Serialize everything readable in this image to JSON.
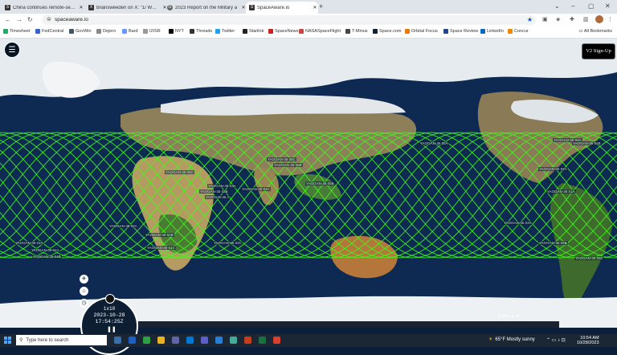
{
  "browser": {
    "tabs": [
      {
        "title": "China continues remote-sens",
        "icon": "S",
        "active": false
      },
      {
        "title": "briansweeden on X: \"1/ While",
        "icon": "X",
        "active": false
      },
      {
        "title": "2023 Report on the Military a",
        "icon": "G",
        "active": false
      },
      {
        "title": "SpaceAware.io",
        "icon": "S",
        "active": true
      }
    ],
    "new_tab": "+",
    "url": "spaceaware.io",
    "bookmarks": [
      "Timesheet",
      "FedCentral",
      "GovWin",
      "Dejero",
      "Bard",
      "I2ISR",
      "NYT",
      "Threads",
      "Twitter",
      "Starlink",
      "SpaceNews",
      "NASASpaceFlight",
      "T-Minus",
      "Space.com",
      "Orbital Focus",
      "Space Review",
      "LinkedIn",
      "Concur"
    ],
    "all_bookmarks": "All Bookmarks"
  },
  "app": {
    "signup_label": "V2 Sign-Up",
    "clock": {
      "speed": "1x10",
      "date": "2023-10-28",
      "time": "17:54:25Z"
    },
    "zoom_label": "1 DAY",
    "orbit_color": "#39ff14",
    "satellites": [
      {
        "name": "YAOGAN-39 05C"
      },
      {
        "name": "YAOGAN-36 06C"
      },
      {
        "name": "YAOGAN-36 06B"
      },
      {
        "name": "YAOGAN-36 05B"
      },
      {
        "name": "YAOGAN-36 05A"
      },
      {
        "name": "YAOGAN-35 03A"
      },
      {
        "name": "YAOGAN-35 03B"
      },
      {
        "name": "YAOGAN-35 04A"
      },
      {
        "name": "YAOGAN-35 A"
      },
      {
        "name": "YAOGAN-36 04A"
      },
      {
        "name": "YAOGAN-36 04B"
      },
      {
        "name": "YAOGAN-36 02A"
      },
      {
        "name": "YAOGAN-36 01A"
      },
      {
        "name": "YAOGAN-39 02A"
      },
      {
        "name": "YAOGAN-39 03B"
      },
      {
        "name": "YAOGAN-39 01C"
      },
      {
        "name": "YAOGAN-39 01A"
      },
      {
        "name": "YAOGAN-39 04A"
      },
      {
        "name": "YAOGAN-35 04B"
      },
      {
        "name": "YAOGAN-35 02C"
      },
      {
        "name": "YAOGAN-36 03A"
      },
      {
        "name": "YAOGAN-36 05B"
      },
      {
        "name": "YAOGAN-36 05C"
      }
    ]
  },
  "taskbar": {
    "search_placeholder": "Type here to search",
    "weather": "65°F  Mostly sunny",
    "time": "10:54 AM",
    "date": "10/28/2023"
  }
}
